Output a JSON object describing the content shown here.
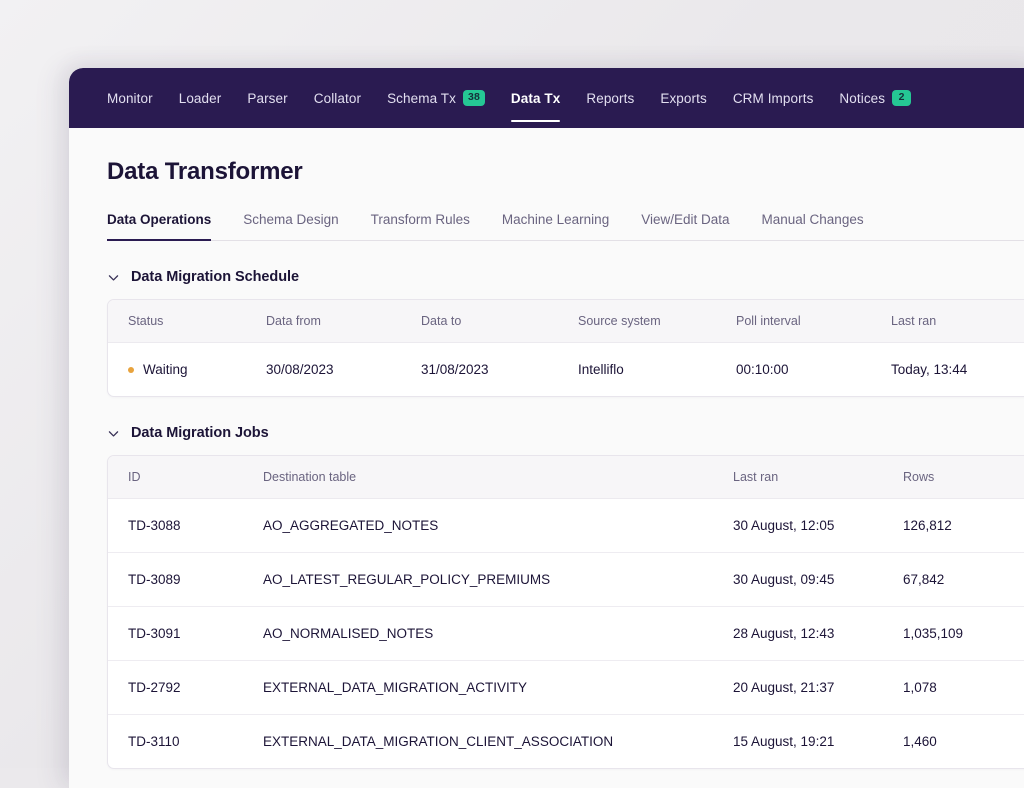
{
  "topnav": {
    "items": [
      {
        "label": "Monitor",
        "badge": null,
        "active": false
      },
      {
        "label": "Loader",
        "badge": null,
        "active": false
      },
      {
        "label": "Parser",
        "badge": null,
        "active": false
      },
      {
        "label": "Collator",
        "badge": null,
        "active": false
      },
      {
        "label": "Schema Tx",
        "badge": "38",
        "active": false
      },
      {
        "label": "Data Tx",
        "badge": null,
        "active": true
      },
      {
        "label": "Reports",
        "badge": null,
        "active": false
      },
      {
        "label": "Exports",
        "badge": null,
        "active": false
      },
      {
        "label": "CRM Imports",
        "badge": null,
        "active": false
      },
      {
        "label": "Notices",
        "badge": "2",
        "active": false
      }
    ]
  },
  "page": {
    "title": "Data Transformer"
  },
  "subtabs": {
    "items": [
      {
        "label": "Data Operations",
        "active": true
      },
      {
        "label": "Schema Design",
        "active": false
      },
      {
        "label": "Transform Rules",
        "active": false
      },
      {
        "label": "Machine Learning",
        "active": false
      },
      {
        "label": "View/Edit Data",
        "active": false
      },
      {
        "label": "Manual Changes",
        "active": false
      }
    ]
  },
  "schedule_section": {
    "title": "Data Migration Schedule",
    "chevron_icon": "chevron-down-icon",
    "columns": [
      "Status",
      "Data from",
      "Data to",
      "Source system",
      "Poll interval",
      "Last ran"
    ],
    "rows": [
      {
        "status": "Waiting",
        "status_color": "#e8a33d",
        "data_from": "30/08/2023",
        "data_to": "31/08/2023",
        "source_system": "Intelliflo",
        "poll_interval": "00:10:00",
        "last_ran": "Today, 13:44"
      }
    ]
  },
  "jobs_section": {
    "title": "Data Migration Jobs",
    "chevron_icon": "chevron-down-icon",
    "columns": [
      "ID",
      "Destination table",
      "Last ran",
      "Rows"
    ],
    "rows": [
      {
        "id": "TD-3088",
        "destination_table": "AO_AGGREGATED_NOTES",
        "last_ran": "30 August, 12:05",
        "rows": "126,812"
      },
      {
        "id": "TD-3089",
        "destination_table": "AO_LATEST_REGULAR_POLICY_PREMIUMS",
        "last_ran": "30 August, 09:45",
        "rows": "67,842"
      },
      {
        "id": "TD-3091",
        "destination_table": "AO_NORMALISED_NOTES",
        "last_ran": "28 August, 12:43",
        "rows": "1,035,109"
      },
      {
        "id": "TD-2792",
        "destination_table": "EXTERNAL_DATA_MIGRATION_ACTIVITY",
        "last_ran": "20 August, 21:37",
        "rows": "1,078"
      },
      {
        "id": "TD-3110",
        "destination_table": "EXTERNAL_DATA_MIGRATION_CLIENT_ASSOCIATION",
        "last_ran": "15 August, 19:21",
        "rows": "1,460"
      }
    ]
  },
  "colors": {
    "navbar": "#2a1b51",
    "badge_green": "#25c794",
    "accent_dark": "#1c1437",
    "status_waiting": "#e8a33d",
    "page_bg": "#fafafa"
  }
}
